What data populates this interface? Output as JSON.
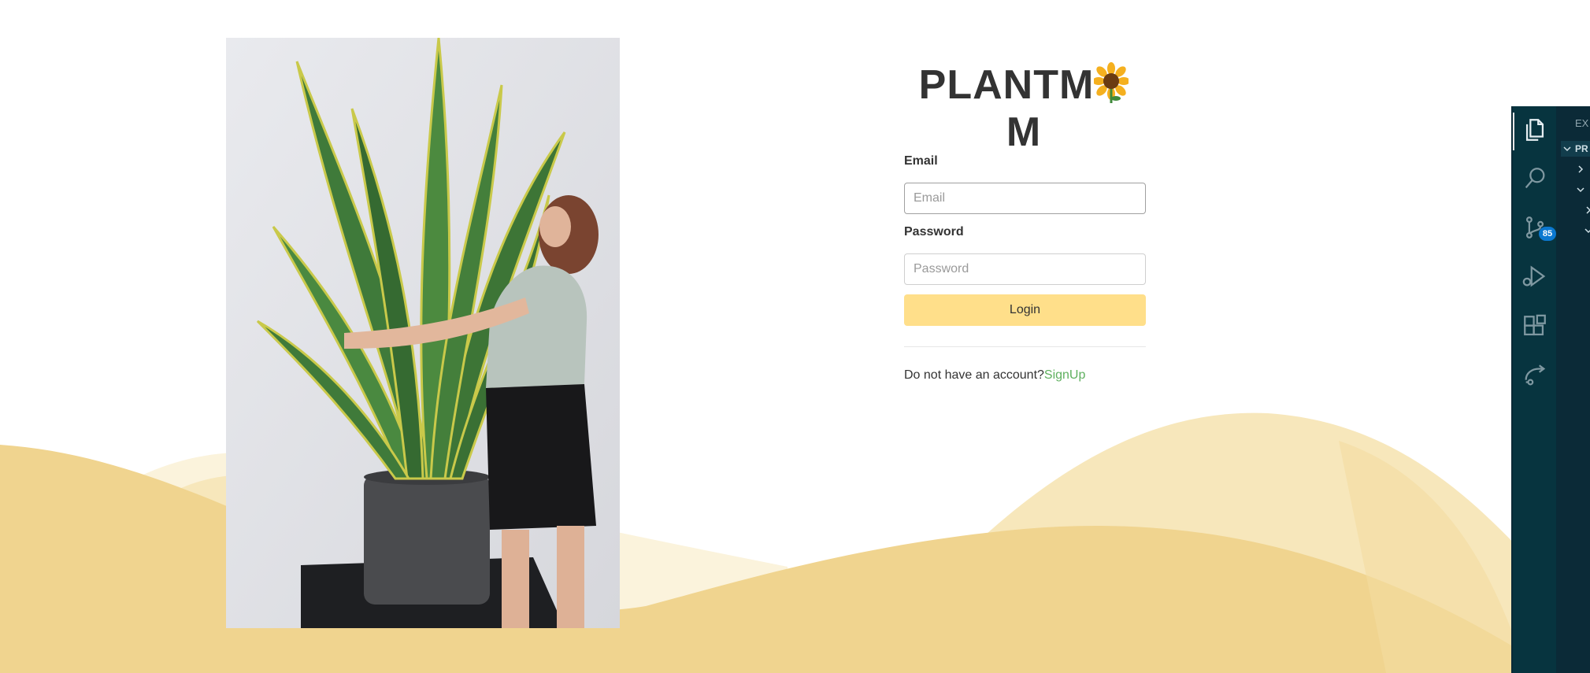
{
  "brand": {
    "name_part1": "PLANTM",
    "name_part2": "M",
    "flower_icon": "sunflower-icon"
  },
  "form": {
    "email_label": "Email",
    "email_placeholder": "Email",
    "email_value": "",
    "password_label": "Password",
    "password_placeholder": "Password",
    "password_value": "",
    "login_label": "Login"
  },
  "signup": {
    "prompt": "Do not have an account?",
    "link": "SignUp"
  },
  "ide": {
    "explorer_title": "EX",
    "section_label": "PR",
    "source_control_badge": "85",
    "icons": [
      "files-icon",
      "search-icon",
      "source-control-icon",
      "run-debug-icon",
      "extensions-icon",
      "remote-share-icon"
    ]
  },
  "colors": {
    "wave_dark": "#f0d48f",
    "wave_light": "#f7e7bb",
    "wave_pale": "#fbf3dc",
    "login_button": "#ffdf8a",
    "signup_link": "#5fb05f",
    "ide_bar": "#07343f",
    "badge": "#0b78d0"
  }
}
